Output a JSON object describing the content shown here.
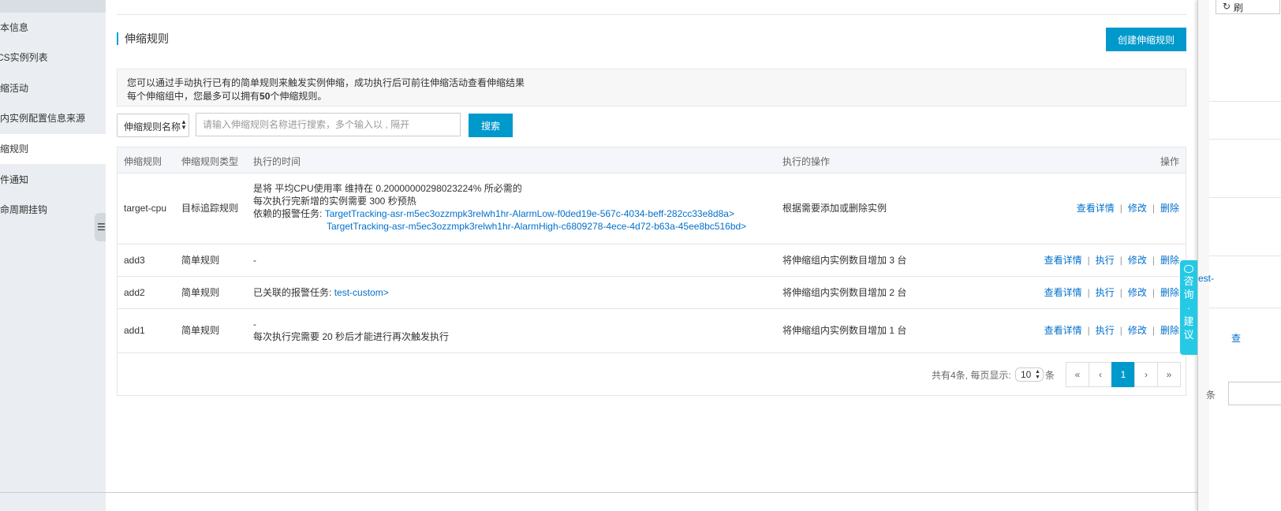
{
  "sidebar": {
    "items": [
      {
        "label": "本信息"
      },
      {
        "label": "CS实例列表"
      },
      {
        "label": "缩活动"
      },
      {
        "label": "内实例配置信息来源"
      },
      {
        "label": "缩规则"
      },
      {
        "label": "件通知"
      },
      {
        "label": "命周期挂钩"
      }
    ],
    "collapse_icon": "collapse-icon"
  },
  "section": {
    "title": "伸缩规则",
    "create_button": "创建伸缩规则"
  },
  "notice": {
    "line1": "您可以通过手动执行已有的简单规则来触发实例伸缩，成功执行后可前往伸缩活动查看伸缩结果",
    "line2_prefix": "每个伸缩组中，您最多可以拥有",
    "line2_bold": "50",
    "line2_suffix": "个伸缩规则。"
  },
  "search": {
    "filter_value": "伸缩规则名称",
    "placeholder": "请输入伸缩规则名称进行搜索，多个输入以 , 隔开",
    "button": "搜索"
  },
  "table": {
    "headers": {
      "name": "伸缩规则",
      "type": "伸缩规则类型",
      "time": "执行的时间",
      "action": "执行的操作",
      "ops": "操作"
    },
    "rows": [
      {
        "name": "target-cpu",
        "type": "目标追踪规则",
        "time_l1": "是将 平均CPU使用率 维持在 0.20000000298023224% 所必需的",
        "time_l2": "每次执行完新增的实例需要 300 秒预热",
        "time_l3_label": "依赖的报警任务:",
        "time_l3_link": "TargetTracking-asr-m5ec3ozzmpk3relwh1hr-AlarmLow-f0ded19e-567c-4034-beff-282cc33e8d8a>",
        "time_l4_link": "TargetTracking-asr-m5ec3ozzmpk3relwh1hr-AlarmHigh-c6809278-4ece-4d72-b63a-45ee8bc516bd>",
        "action": "根据需要添加或删除实例",
        "op_detail": "查看详情",
        "op_edit": "修改",
        "op_delete": "删除"
      },
      {
        "name": "add3",
        "type": "简单规则",
        "time_l1": "-",
        "action": "将伸缩组内实例数目增加 3 台",
        "op_detail": "查看详情",
        "op_exec": "执行",
        "op_edit": "修改",
        "op_delete": "删除"
      },
      {
        "name": "add2",
        "type": "简单规则",
        "time_label": "已关联的报警任务:",
        "time_link": "test-custom>",
        "action": "将伸缩组内实例数目增加 2 台",
        "op_detail": "查看详情",
        "op_exec": "执行",
        "op_edit": "修改",
        "op_delete": "删除"
      },
      {
        "name": "add1",
        "type": "简单规则",
        "time_l1": "-",
        "time_l2": "每次执行完需要 20 秒后才能进行再次触发执行",
        "action": "将伸缩组内实例数目增加 1 台",
        "op_detail": "查看详情",
        "op_exec": "执行",
        "op_edit": "修改",
        "op_delete": "删除"
      }
    ]
  },
  "pagination": {
    "total": "共有4条, 每页显示:",
    "page_size": "10",
    "unit": "条",
    "first": "«",
    "prev": "‹",
    "current": "1",
    "next": "›",
    "last": "»"
  },
  "consult": {
    "c1": "咨",
    "c2": "询",
    "c3": "·",
    "c4": "建",
    "c5": "议"
  },
  "right_panel": {
    "refresh_icon": "refresh-icon",
    "refresh_label": "刷",
    "text1": "est-",
    "text2": "查",
    "text3": "条"
  },
  "colors": {
    "primary": "#0099cc",
    "link": "#0070cc",
    "consult": "#24c9e5",
    "accent_bar": "#00a2ca"
  }
}
